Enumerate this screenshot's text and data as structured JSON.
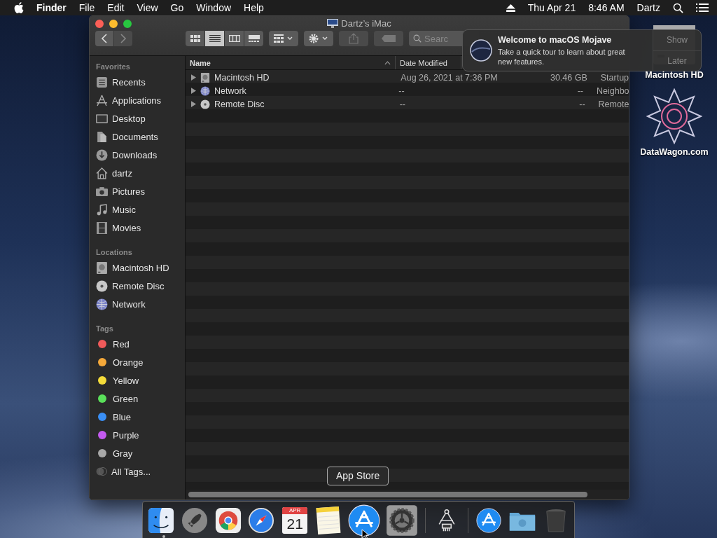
{
  "menu_bar": {
    "app_name": "Finder",
    "items": [
      "File",
      "Edit",
      "View",
      "Go",
      "Window",
      "Help"
    ],
    "date": "Thu Apr 21",
    "time": "8:46 AM",
    "user": "Dartz"
  },
  "window": {
    "title": "Dartz’s iMac",
    "view_modes": [
      {
        "kind": "icons",
        "selected": false
      },
      {
        "kind": "list",
        "selected": true
      },
      {
        "kind": "columns",
        "selected": false
      },
      {
        "kind": "gallery",
        "selected": false
      }
    ],
    "search": {
      "placeholder": "Searc"
    },
    "sidebar": [
      {
        "heading": "Favorites",
        "items": [
          {
            "label": "Recents",
            "kind": "recents"
          },
          {
            "label": "Applications",
            "kind": "apps"
          },
          {
            "label": "Desktop",
            "kind": "desktop"
          },
          {
            "label": "Documents",
            "kind": "documents"
          },
          {
            "label": "Downloads",
            "kind": "downloads"
          },
          {
            "label": "dartz",
            "kind": "home"
          },
          {
            "label": "Pictures",
            "kind": "pictures"
          },
          {
            "label": "Music",
            "kind": "music"
          },
          {
            "label": "Movies",
            "kind": "movies"
          }
        ]
      },
      {
        "heading": "Locations",
        "items": [
          {
            "label": "Macintosh HD",
            "kind": "disk"
          },
          {
            "label": "Remote Disc",
            "kind": "disc"
          },
          {
            "label": "Network",
            "kind": "network"
          }
        ]
      },
      {
        "heading": "Tags",
        "items": [
          {
            "label": "Red",
            "kind": "tag",
            "color": "#f05a5a"
          },
          {
            "label": "Orange",
            "kind": "tag",
            "color": "#f5a93a"
          },
          {
            "label": "Yellow",
            "kind": "tag",
            "color": "#f5dc3a"
          },
          {
            "label": "Green",
            "kind": "tag",
            "color": "#5ae05a"
          },
          {
            "label": "Blue",
            "kind": "tag",
            "color": "#3a8ff5"
          },
          {
            "label": "Purple",
            "kind": "tag",
            "color": "#c45af0"
          },
          {
            "label": "Gray",
            "kind": "tag",
            "color": "#a8a8a8"
          },
          {
            "label": "All Tags...",
            "kind": "alltags"
          }
        ]
      }
    ],
    "columns": [
      "Name",
      "Date Modified"
    ],
    "rows": [
      {
        "name": "Macintosh HD",
        "kind": "disk",
        "expanded": false,
        "date": "Aug 26, 2021 at 7:36 PM",
        "size": "30.46 GB",
        "column_4": "Startup"
      },
      {
        "name": "Network",
        "kind": "network",
        "expanded": false,
        "date": "--",
        "size": "--",
        "column_4": "Neighbo"
      },
      {
        "name": "Remote Disc",
        "kind": "disc",
        "expanded": false,
        "date": "--",
        "size": "--",
        "column_4": "Remote"
      }
    ]
  },
  "notification": {
    "title": "Welcome to macOS Mojave",
    "body": "Take a quick tour to learn about great new features.",
    "buttons": [
      "Show",
      "Later"
    ]
  },
  "desktop_icons": [
    {
      "label": "Macintosh HD",
      "kind": "disk"
    },
    {
      "label": "DataWagon.com",
      "kind": "star"
    }
  ],
  "tooltip": "App Store",
  "dock": [
    {
      "kind": "finder",
      "running": true
    },
    {
      "kind": "launchpad",
      "running": false
    },
    {
      "kind": "chrome",
      "running": false
    },
    {
      "kind": "safari",
      "running": false
    },
    {
      "kind": "calendar",
      "running": false,
      "month": "APR",
      "day": "21"
    },
    {
      "kind": "notes",
      "running": false
    },
    {
      "kind": "appstore",
      "running": false
    },
    {
      "kind": "settings",
      "running": false
    },
    {
      "kind": "separator"
    },
    {
      "kind": "caliper",
      "running": false
    },
    {
      "kind": "separator"
    },
    {
      "kind": "appdownloads",
      "running": false
    },
    {
      "kind": "folder",
      "running": false
    },
    {
      "kind": "trash",
      "running": false
    }
  ]
}
